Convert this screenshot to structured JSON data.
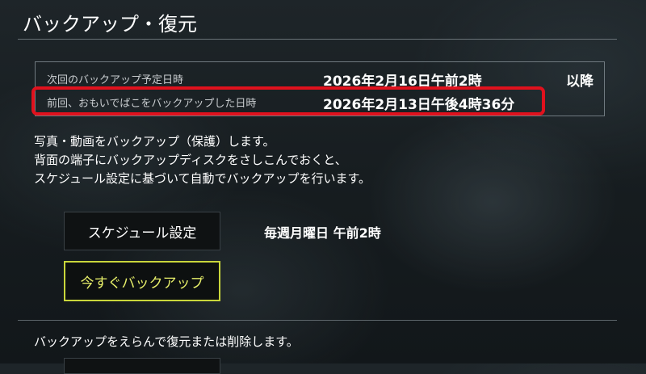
{
  "header": {
    "title": "バックアップ・復元"
  },
  "backup_info": {
    "next": {
      "label": "次回のバックアップ予定日時",
      "value": "2026年2月16日午前2時",
      "suffix": "以降"
    },
    "last": {
      "label": "前回、おもいでばこをバックアップした日時",
      "value": "2026年2月13日午後4時36分"
    },
    "highlight_color": "#e0111d"
  },
  "description": {
    "line1": "写真・動画をバックアップ（保護）します。",
    "line2": "背面の端子にバックアップディスクをさしこんでおくと、",
    "line3": "スケジュール設定に基づいて自動でバックアップを行います。"
  },
  "actions": {
    "schedule_button": "スケジュール設定",
    "schedule_value": "毎週月曜日 午前2時",
    "backup_now_button": "今すぐバックアップ",
    "focus_color": "#c9d63b"
  },
  "restore": {
    "text": "バックアップをえらんで復元または削除します。"
  }
}
